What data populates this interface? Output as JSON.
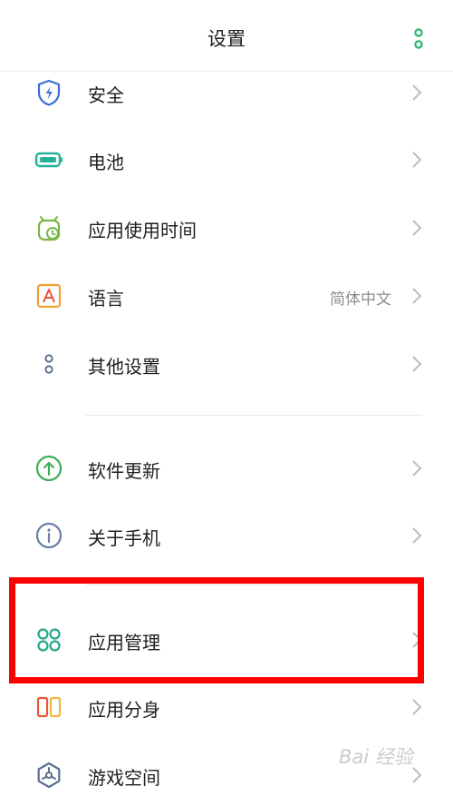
{
  "header": {
    "title": "设置",
    "more_icon": "more-vertical-icon"
  },
  "settings": {
    "security": {
      "label": "安全",
      "icon": "shield-lightning-icon"
    },
    "battery": {
      "label": "电池",
      "icon": "battery-icon"
    },
    "app_usage": {
      "label": "应用使用时间",
      "icon": "alarm-clock-icon"
    },
    "language": {
      "label": "语言",
      "value": "简体中文",
      "icon": "language-a-icon"
    },
    "other_settings": {
      "label": "其他设置",
      "icon": "other-settings-icon"
    },
    "software_update": {
      "label": "软件更新",
      "icon": "update-arrow-icon"
    },
    "about_phone": {
      "label": "关于手机",
      "icon": "info-icon"
    },
    "app_management": {
      "label": "应用管理",
      "icon": "app-grid-icon"
    },
    "app_clone": {
      "label": "应用分身",
      "icon": "app-clone-icon"
    },
    "game_space": {
      "label": "游戏空间",
      "icon": "game-space-icon"
    }
  },
  "colors": {
    "accent_green": "#2bb673",
    "highlight": "#ff0000",
    "chevron": "#bdbdbd"
  },
  "watermark": "Bai 经验"
}
